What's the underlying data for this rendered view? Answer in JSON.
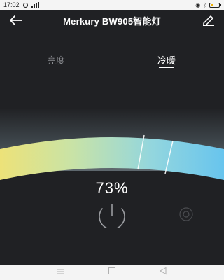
{
  "status_bar": {
    "time": "17:02",
    "icons": [
      "clock-icon",
      "signal-icon",
      "location-icon",
      "bluetooth-icon",
      "battery-icon"
    ]
  },
  "header": {
    "title": "Merkury BW905智能灯",
    "back_icon": "back-arrow-icon",
    "edit_icon": "edit-pencil-icon"
  },
  "tabs": [
    {
      "label": "亮度",
      "active": false
    },
    {
      "label": "冷暖",
      "active": true
    }
  ],
  "slider": {
    "value_percent": 73,
    "gradient": [
      "#f7e26b",
      "#bfe0a8",
      "#8fd4e4",
      "#5bc0f0"
    ],
    "thumb_fraction": 0.73
  },
  "readout": {
    "percent_text": "73%"
  },
  "controls": {
    "power_icon": "power-icon",
    "secondary_icon": "timer-icon"
  },
  "nav_bar": {
    "icons": [
      "menu-icon",
      "home-icon",
      "back-icon"
    ]
  },
  "colors": {
    "background": "#202124",
    "status_bar": "#f4f4f4",
    "accent_text": "#ffffff",
    "inactive_tab": "#8a8c90"
  }
}
